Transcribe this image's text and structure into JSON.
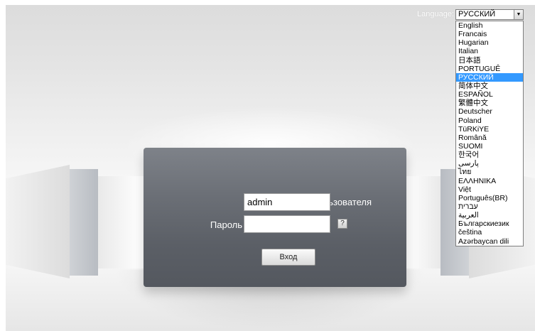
{
  "language": {
    "label": "Language:",
    "selected": "РУССКИЙ",
    "options": [
      "English",
      "Francais",
      "Hugarian",
      "Italian",
      "日本語",
      "PORTUGUÊ",
      "РУССКИЙ",
      "简体中文",
      "ESPAÑOL",
      "繁體中文",
      "Deutscher",
      "Poland",
      "TüRKiYE",
      "Română",
      "SUOMI",
      "한국어",
      "پارسی",
      "ไทย",
      "ΕΛΛΗΝΙΚΑ",
      "Việt",
      "Português(BR)",
      "עברית",
      "العربية",
      "Българскиезик",
      "čeština",
      "Azərbaycan dili"
    ],
    "selected_index": 6
  },
  "login": {
    "username_label": "Имя пользователя",
    "username_value": "admin",
    "password_label": "Пароль",
    "password_value": "",
    "help_label": "?",
    "submit_label": "Вход"
  },
  "colors": {
    "panel": "#5b5f66",
    "selection": "#3399ff"
  }
}
